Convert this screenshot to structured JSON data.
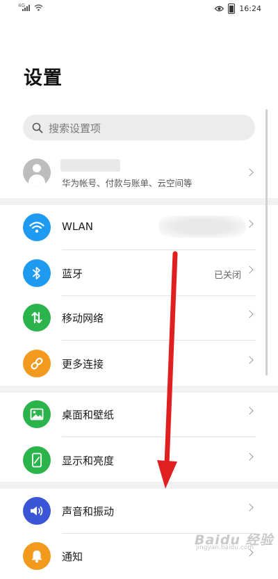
{
  "status_bar": {
    "signal_label": "4G",
    "time": "16:24"
  },
  "page_title": "设置",
  "search": {
    "placeholder": "搜索设置项"
  },
  "account": {
    "subtitle": "华为帐号、付款与账单、云空间等"
  },
  "groups": [
    {
      "items": [
        {
          "label": "WLAN",
          "icon": "wifi-icon",
          "color": "#1e9bf0",
          "value": ""
        },
        {
          "label": "蓝牙",
          "icon": "bluetooth-icon",
          "color": "#1e9bf0",
          "value": "已关闭"
        },
        {
          "label": "移动网络",
          "icon": "mobile-data-icon",
          "color": "#2bb34c",
          "value": ""
        },
        {
          "label": "更多连接",
          "icon": "link-icon",
          "color": "#f29a1d",
          "value": ""
        }
      ]
    },
    {
      "items": [
        {
          "label": "桌面和壁纸",
          "icon": "image-icon",
          "color": "#2bb34c",
          "value": ""
        },
        {
          "label": "显示和亮度",
          "icon": "display-icon",
          "color": "#2bb34c",
          "value": ""
        }
      ]
    },
    {
      "items": [
        {
          "label": "声音和振动",
          "icon": "speaker-icon",
          "color": "#3a55d6",
          "value": ""
        },
        {
          "label": "通知",
          "icon": "bell-icon",
          "color": "#f29a1d",
          "value": ""
        }
      ]
    }
  ],
  "annotation": {
    "arrow_color": "#e02020"
  },
  "watermark": {
    "main": "Baidu 经验",
    "sub": "jingyan.baidu.com"
  }
}
